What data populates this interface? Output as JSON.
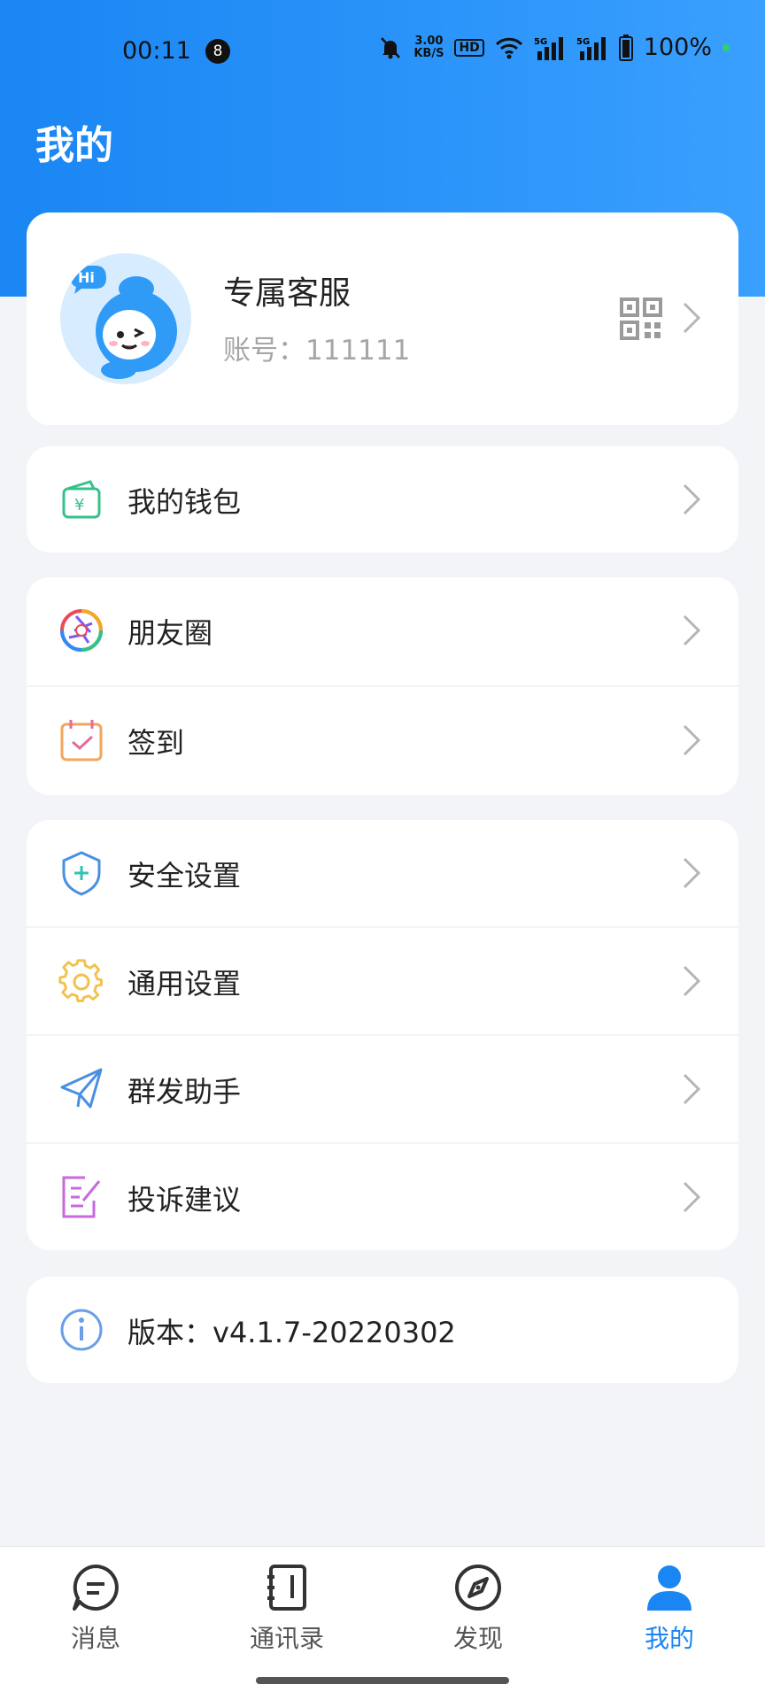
{
  "status_bar": {
    "time": "00:11",
    "notification_count": "8",
    "net_speed_value": "3.00",
    "net_speed_unit": "KB/S",
    "hd_label": "HD",
    "signal1": "5G",
    "signal2": "5G",
    "battery": "100%"
  },
  "header": {
    "title": "我的"
  },
  "profile": {
    "name": "专属客服",
    "account": "账号：111111",
    "avatar_badge": "Hi"
  },
  "menu": {
    "wallet": "我的钱包",
    "moments": "朋友圈",
    "checkin": "签到",
    "security": "安全设置",
    "general": "通用设置",
    "broadcast": "群发助手",
    "feedback": "投诉建议",
    "version": "版本：v4.1.7-20220302"
  },
  "tabs": {
    "messages": "消息",
    "contacts": "通讯录",
    "discover": "发现",
    "me": "我的"
  },
  "colors": {
    "accent": "#1a86f3",
    "background": "#f2f4f7",
    "card": "#ffffff"
  }
}
